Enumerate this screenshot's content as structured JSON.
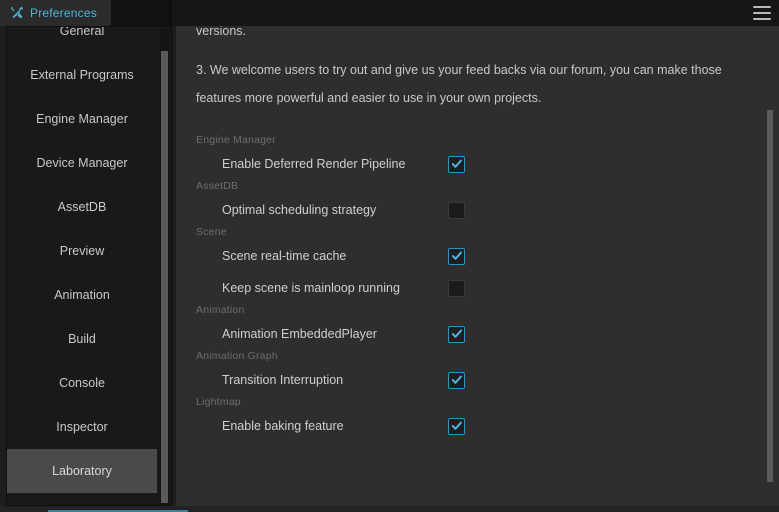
{
  "window": {
    "tab": {
      "label": "Preferences",
      "icon": "tools-wrench-icon"
    },
    "menu_icon": "hamburger-menu-icon",
    "accent_color": "#4fb4dd",
    "checkbox_accent": "#2a93c9",
    "background": "#2e2e2e"
  },
  "sidebar": {
    "items": [
      {
        "label": "General",
        "selected": false
      },
      {
        "label": "External Programs",
        "selected": false
      },
      {
        "label": "Engine Manager",
        "selected": false
      },
      {
        "label": "Device Manager",
        "selected": false
      },
      {
        "label": "AssetDB",
        "selected": false
      },
      {
        "label": "Preview",
        "selected": false
      },
      {
        "label": "Animation",
        "selected": false
      },
      {
        "label": "Build",
        "selected": false
      },
      {
        "label": "Console",
        "selected": false
      },
      {
        "label": "Inspector",
        "selected": false
      },
      {
        "label": "Laboratory",
        "selected": true
      }
    ]
  },
  "content": {
    "intro": {
      "clipped_line": "versions.",
      "paragraph": "3. We welcome users to try out and give us your feed backs via our forum, you can make those features more powerful and easier to use in your own projects."
    },
    "groups": [
      {
        "title": "Engine Manager",
        "options": [
          {
            "label": "Enable Deferred Render Pipeline",
            "checked": true
          }
        ]
      },
      {
        "title": "AssetDB",
        "options": [
          {
            "label": "Optimal scheduling strategy",
            "checked": false
          }
        ]
      },
      {
        "title": "Scene",
        "options": [
          {
            "label": "Scene real-time cache",
            "checked": true
          },
          {
            "label": "Keep scene is mainloop running",
            "checked": false
          }
        ]
      },
      {
        "title": "Animation",
        "options": [
          {
            "label": "Animation EmbeddedPlayer",
            "checked": true
          }
        ]
      },
      {
        "title": "Animation Graph",
        "options": [
          {
            "label": "Transition Interruption",
            "checked": true
          }
        ]
      },
      {
        "title": "Lightmap",
        "options": [
          {
            "label": "Enable baking feature",
            "checked": true
          }
        ]
      }
    ]
  }
}
